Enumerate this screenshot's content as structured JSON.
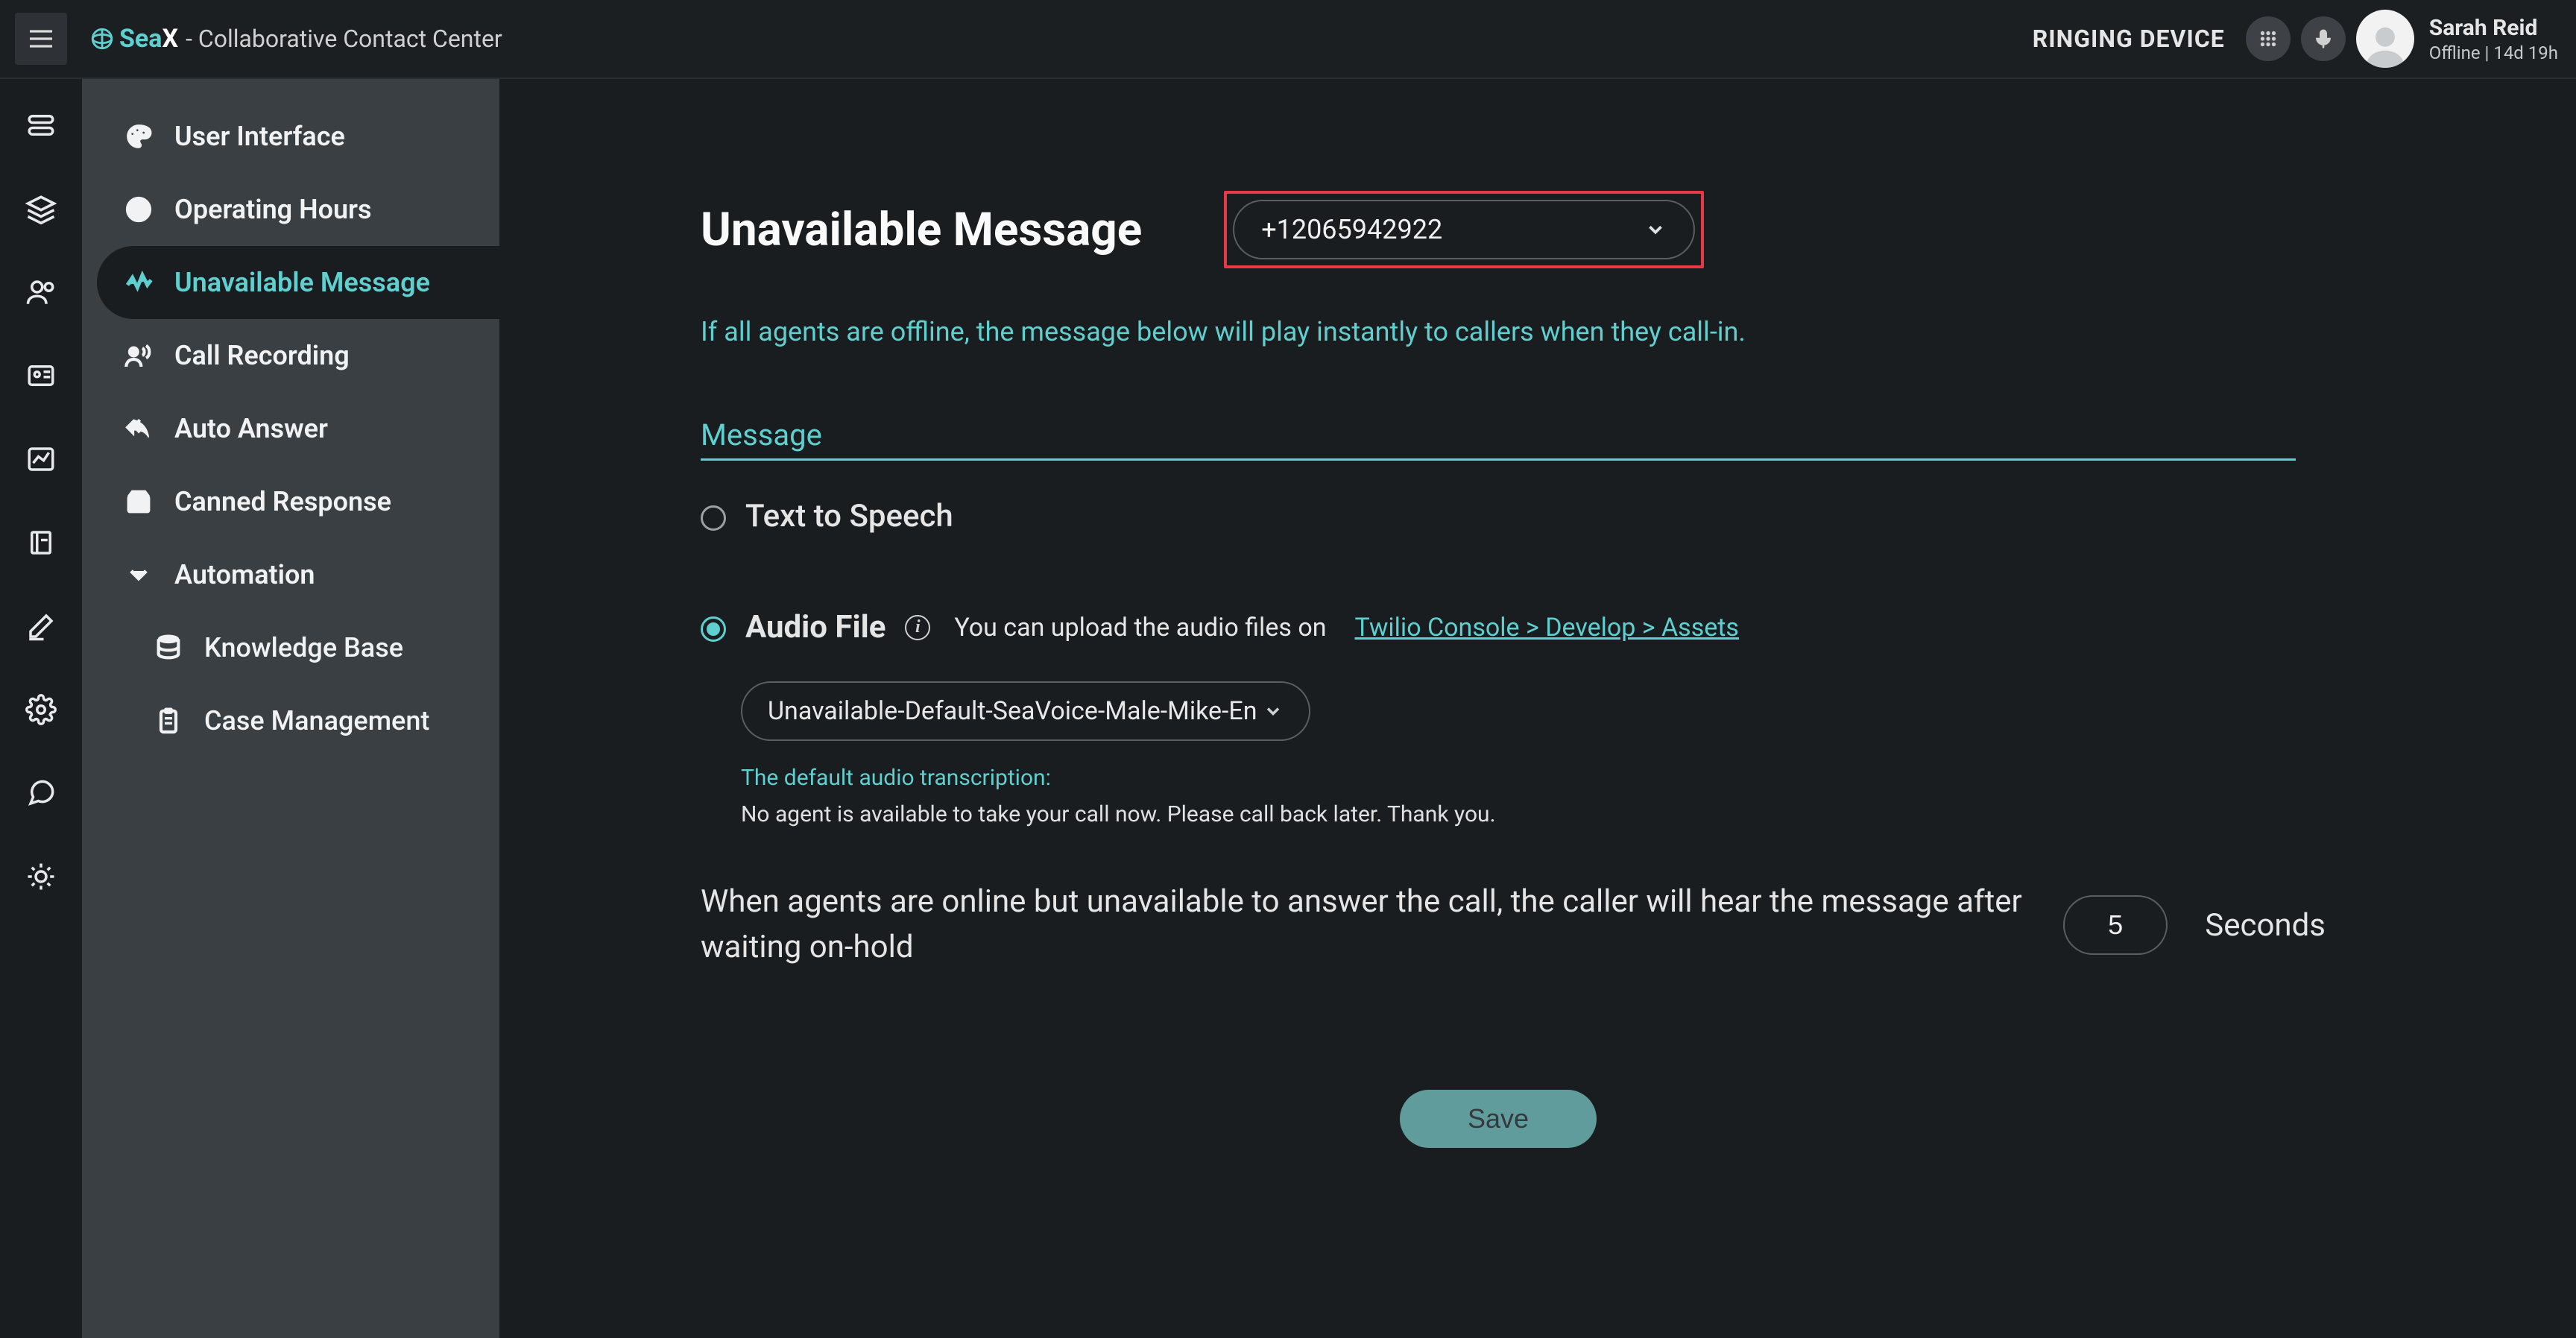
{
  "header": {
    "brand_prefix": "Sea",
    "brand_suffix_char": "X",
    "app_subtitle": " - Collaborative Contact Center",
    "ringing_label": "RINGING DEVICE",
    "user_name": "Sarah Reid",
    "user_status": "Offline | 14d 19h"
  },
  "sidebar": {
    "items": [
      {
        "label": "User Interface",
        "icon": "palette"
      },
      {
        "label": "Operating Hours",
        "icon": "clock"
      },
      {
        "label": "Unavailable Message",
        "icon": "message",
        "active": true
      },
      {
        "label": "Call Recording",
        "icon": "record"
      },
      {
        "label": "Auto Answer",
        "icon": "reply"
      },
      {
        "label": "Canned Response",
        "icon": "canned"
      },
      {
        "label": "Automation",
        "icon": "chevron"
      },
      {
        "label": "Knowledge Base",
        "icon": "database",
        "sub": true
      },
      {
        "label": "Case Management",
        "icon": "clipboard",
        "sub": true
      }
    ]
  },
  "main": {
    "title": "Unavailable Message",
    "phone_selected": "+12065942922",
    "intro": "If all agents are offline, the message below will play instantly to callers when they call-in.",
    "section_label": "Message",
    "option_tts_label": "Text to Speech",
    "option_audio_label": "Audio File",
    "audio_hint_prefix": "You can upload the audio files on",
    "audio_hint_link": "Twilio Console > Develop > Assets",
    "audio_selected": "Unavailable-Default-SeaVoice-Male-Mike-En",
    "transcription_label": "The default audio transcription:",
    "transcription_text": "No agent is available to take your call now. Please call back later. Thank you.",
    "wait_text": "When agents are online but unavailable to answer the call, the caller will hear the message after waiting on-hold",
    "wait_seconds": "5",
    "wait_unit": "Seconds",
    "save_label": "Save"
  }
}
